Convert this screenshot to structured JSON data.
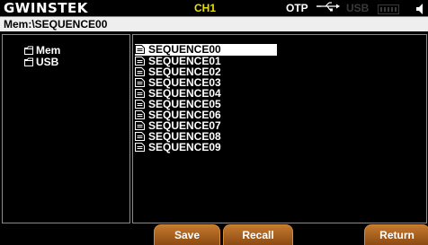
{
  "header": {
    "brand": "GWINSTEK",
    "channel": "CH1",
    "otp": "OTP",
    "usb": "USB"
  },
  "path": "Mem:\\SEQUENCE00",
  "tree": [
    {
      "label": "Mem"
    },
    {
      "label": "USB"
    }
  ],
  "files": [
    {
      "name": "SEQUENCE00",
      "selected": true
    },
    {
      "name": "SEQUENCE01"
    },
    {
      "name": "SEQUENCE02"
    },
    {
      "name": "SEQUENCE03"
    },
    {
      "name": "SEQUENCE04"
    },
    {
      "name": "SEQUENCE05"
    },
    {
      "name": "SEQUENCE06"
    },
    {
      "name": "SEQUENCE07"
    },
    {
      "name": "SEQUENCE08"
    },
    {
      "name": "SEQUENCE09"
    }
  ],
  "softkeys": {
    "save": "Save",
    "recall": "Recall",
    "return": "Return"
  },
  "colors": {
    "channel": "#e8e000",
    "softkey": "#a8621f",
    "selection": "#ffffff"
  }
}
